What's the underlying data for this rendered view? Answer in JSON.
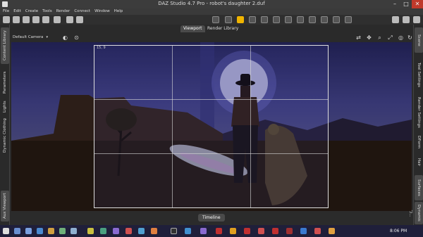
{
  "window": {
    "title": "DAZ Studio 4.7 Pro - robot's daughter 2.duf",
    "minimize": "–",
    "maximize": "□",
    "close": "✕"
  },
  "menu": [
    "File",
    "Edit",
    "Create",
    "Tools",
    "Render",
    "Connect",
    "Window",
    "Help"
  ],
  "left_tabs": [
    "Content Library",
    "Parameters",
    "Lights",
    "Dynamic Clothing",
    "Aux Viewport"
  ],
  "right_tabs": [
    "Scene",
    "Tool Settings",
    "Render Settings",
    "Surfaces",
    "DForm",
    "Hair",
    "Dynamic Cl..."
  ],
  "viewport_tabs": [
    "Viewport",
    "Render Library"
  ],
  "camera": {
    "label": "Default Camera",
    "arrow": "▾"
  },
  "frame_info": "15, 9",
  "bottom_tab": "Timeline",
  "taskbar": {
    "time": "8:06 PM"
  },
  "colors": {
    "accent": "#f0b400",
    "close": "#c0392b",
    "taskbar": "#1f1f3a"
  }
}
